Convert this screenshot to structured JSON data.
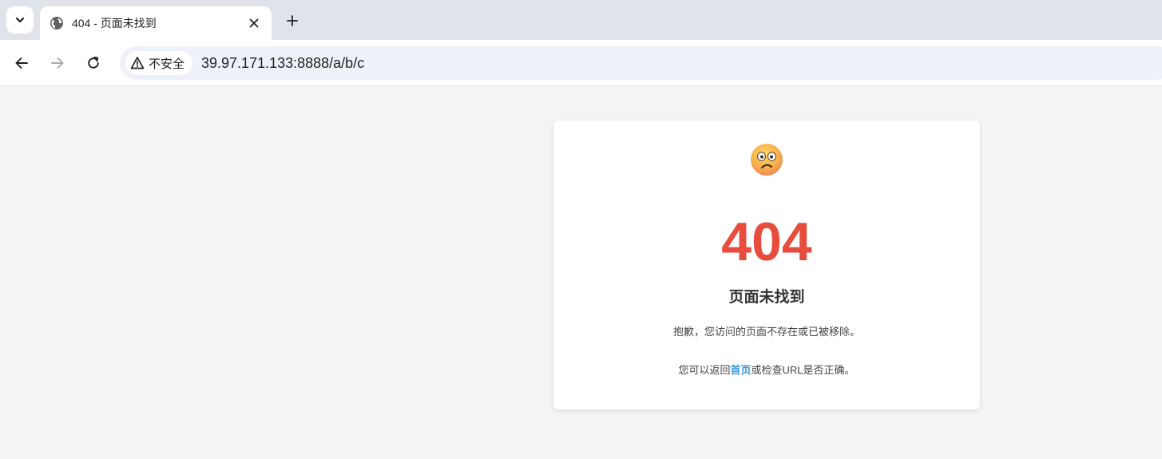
{
  "browser": {
    "tab": {
      "title": "404 - 页面未找到"
    },
    "address_bar": {
      "security_label": "不安全",
      "url": "39.97.171.133:8888/a/b/c"
    }
  },
  "page": {
    "error_code": "404",
    "title": "页面未找到",
    "description": "抱歉，您访问的页面不存在或已被移除。",
    "help_prefix": "您可以返回",
    "home_link": "首页",
    "help_suffix": "或检查URL是否正确。"
  },
  "colors": {
    "error": "#e74c3c",
    "link": "#3498db"
  },
  "icons": {
    "tab_search": "chevron-down-icon",
    "favicon": "globe-icon",
    "close": "close-icon",
    "new_tab": "plus-icon",
    "back": "arrow-left-icon",
    "forward": "arrow-right-icon",
    "reload": "reload-icon",
    "security": "warning-triangle-icon",
    "emoji": "confused-face-icon"
  }
}
